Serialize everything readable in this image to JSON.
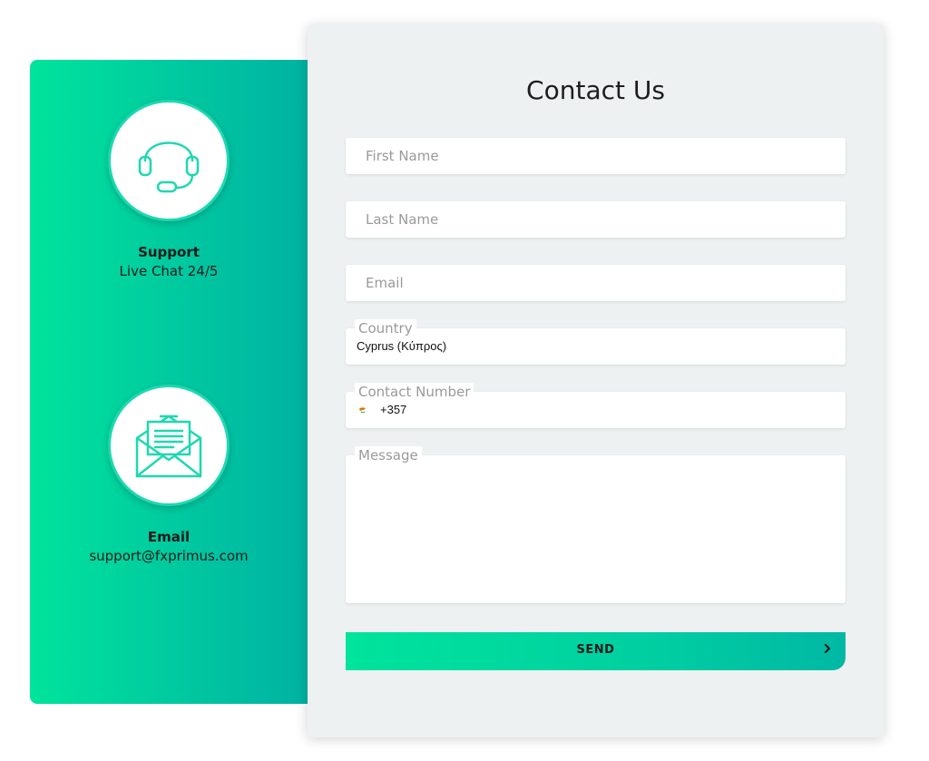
{
  "left_panel": {
    "support": {
      "icon": "headset-icon",
      "title": "Support",
      "subtitle": "Live Chat 24/5"
    },
    "email": {
      "icon": "envelope-letter-icon",
      "title": "Email",
      "subtitle": "support@fxprimus.com"
    }
  },
  "form": {
    "title": "Contact Us",
    "first_name": {
      "placeholder": "First Name",
      "value": ""
    },
    "last_name": {
      "placeholder": "Last Name",
      "value": ""
    },
    "email": {
      "placeholder": "Email",
      "value": ""
    },
    "country": {
      "label": "Country",
      "value": "Cyprus (Κύπρος)"
    },
    "contact_number": {
      "label": "Contact Number",
      "flag_icon": "cyprus-flag-icon",
      "code": "+357"
    },
    "message": {
      "label": "Message",
      "value": ""
    },
    "send_label": "SEND",
    "send_icon": "chevron-right-icon"
  },
  "colors": {
    "accent_start": "#00e49c",
    "accent_end": "#00b0a3",
    "icon_stroke": "#1ed8b0",
    "card_bg": "#eef1f2"
  }
}
